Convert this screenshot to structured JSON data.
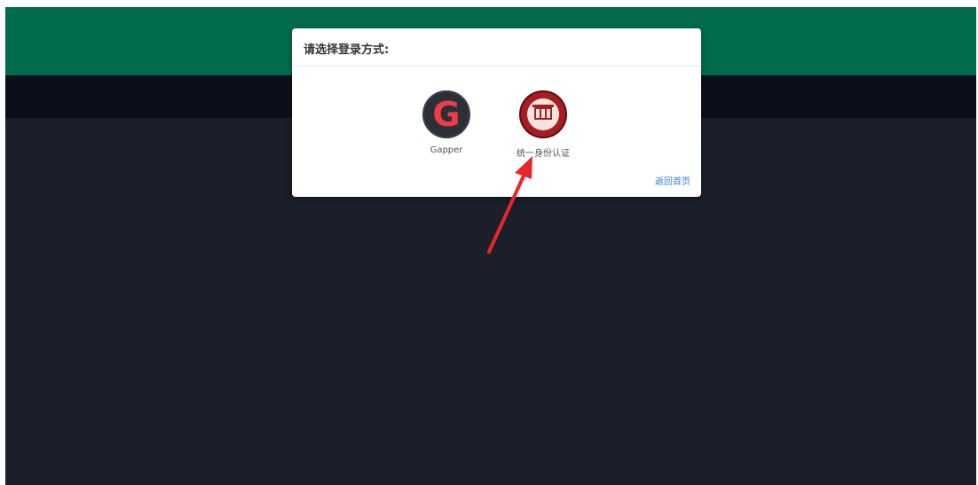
{
  "dialog": {
    "title": "请选择登录方式:",
    "back_label": "返回首页"
  },
  "login_options": [
    {
      "label": "Gapper",
      "icon": "gapper-logo-icon"
    },
    {
      "label": "统一身份认证",
      "icon": "university-seal-icon"
    }
  ],
  "colors": {
    "header_green": "#006c4c",
    "nav_dark": "#0b0f19",
    "page_bg": "#1a1f29",
    "link_blue": "#2f7fd1",
    "arrow_red": "#e8262a"
  }
}
